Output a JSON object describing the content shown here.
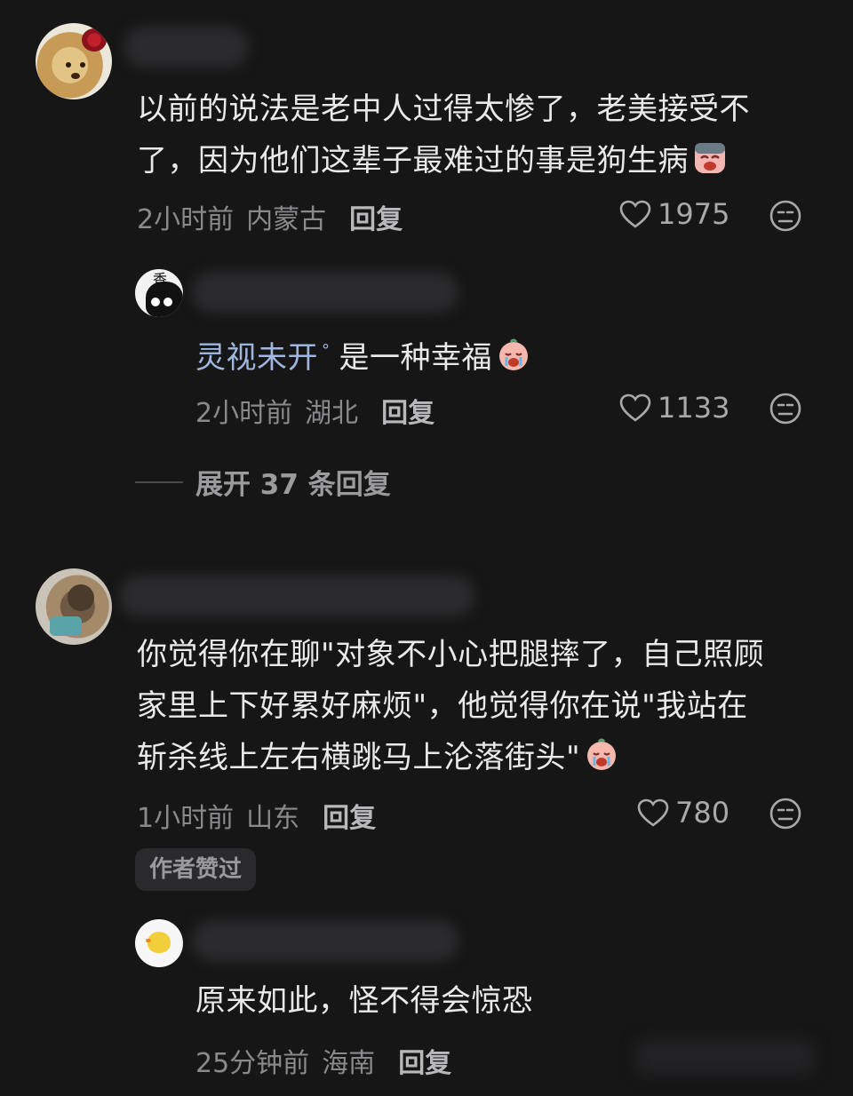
{
  "comments": [
    {
      "lines": [
        "以前的说法是老中人过得太惨了，老美接受不",
        "了，因为他们这辈子最难过的事是狗生病"
      ],
      "emoji": "crying-face",
      "time": "2小时前",
      "location": "内蒙古",
      "reply_label": "回复",
      "likes": "1975",
      "reply": {
        "name": "灵视未开",
        "name_suffix": "°",
        "text": "是一种幸福",
        "emoji": "crying-baby",
        "time": "2小时前",
        "location": "湖北",
        "reply_label": "回复",
        "likes": "1133"
      },
      "expand_label": "展开 37 条回复"
    },
    {
      "lines": [
        "你觉得你在聊\"对象不小心把腿摔了，自己照顾",
        "家里上下好累好麻烦\"，他觉得你在说\"我站在",
        "斩杀线上左右横跳马上沦落街头\""
      ],
      "emoji": "crying-baby",
      "time": "1小时前",
      "location": "山东",
      "reply_label": "回复",
      "likes": "780",
      "badge": "作者赞过",
      "reply": {
        "text": "原来如此，怪不得会惊恐",
        "time": "25分钟前",
        "location": "海南",
        "reply_label": "回复"
      }
    }
  ],
  "colors": {
    "background": "#161617",
    "text": "#e9e9ea",
    "meta": "#8a8a8d",
    "reply_name": "#9fb6df"
  }
}
